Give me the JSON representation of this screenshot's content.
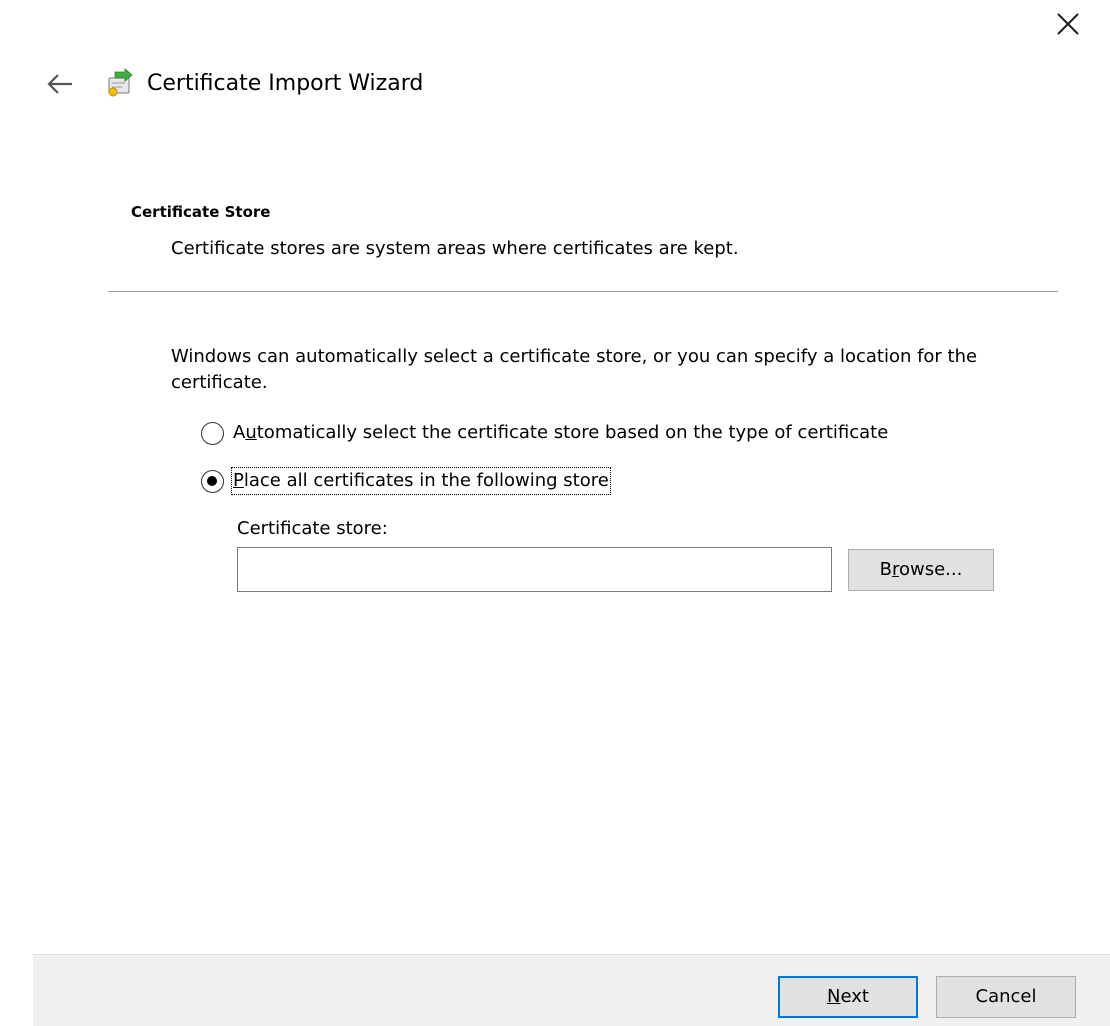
{
  "window": {
    "title": "Certificate Import Wizard",
    "close_icon": "close-icon",
    "back_icon": "back-arrow-icon",
    "app_icon": "certificate-icon"
  },
  "header": {
    "heading": "Certificate Store",
    "description": "Certificate stores are system areas where certificates are kept."
  },
  "body": {
    "intro": "Windows can automatically select a certificate store, or you can specify a location for the certificate.",
    "options": {
      "auto": {
        "mnemonic_pre": "A",
        "mnemonic": "u",
        "rest": "tomatically select the certificate store based on the type of certificate",
        "selected": false
      },
      "place": {
        "mnemonic": "P",
        "rest": "lace all certificates in the following store",
        "selected": true
      }
    },
    "store": {
      "label": "Certificate store:",
      "value": "",
      "browse": {
        "pre": "B",
        "mnemonic": "r",
        "rest": "owse..."
      }
    }
  },
  "footer": {
    "next": {
      "mnemonic": "N",
      "rest": "ext"
    },
    "cancel": "Cancel"
  },
  "colors": {
    "default_button_border": "#0078d7",
    "footer_background": "#f0f0f0",
    "button_face": "#e1e1e1"
  }
}
